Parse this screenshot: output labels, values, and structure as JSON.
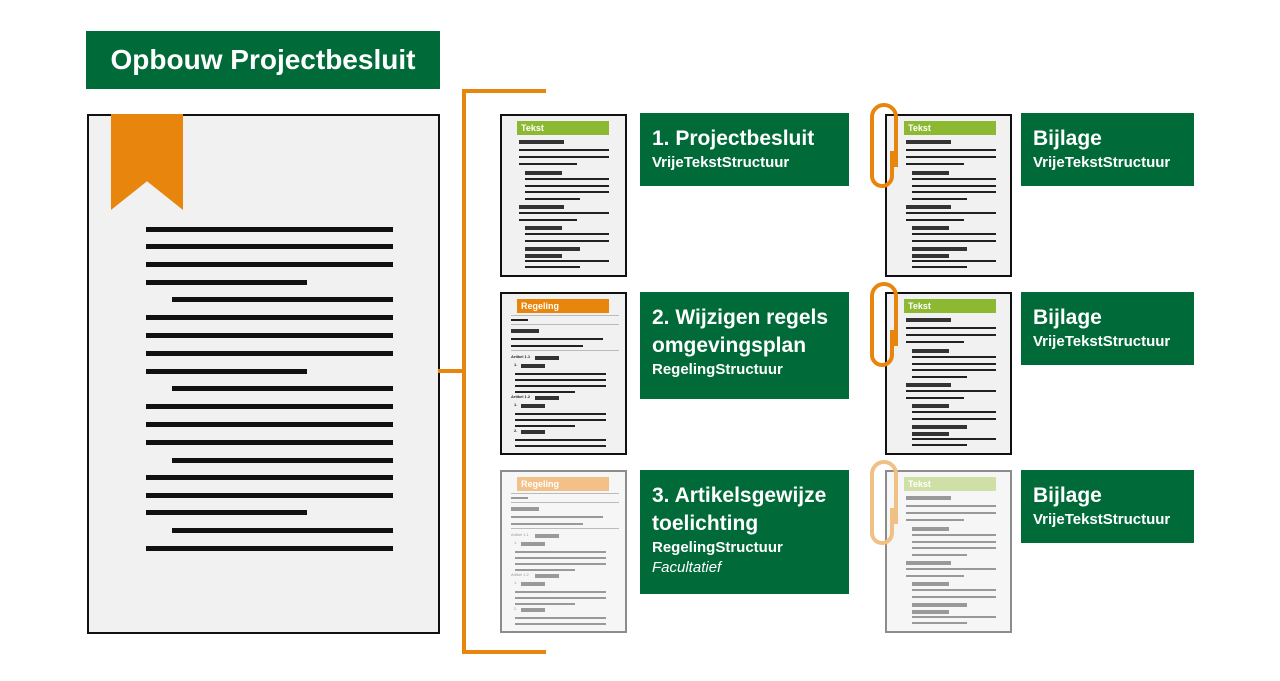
{
  "title": "Opbouw Projectbesluit",
  "colors": {
    "green": "#006b38",
    "orange": "#e8850c",
    "light_green": "#8db832"
  },
  "parts": [
    {
      "label": "1. Projectbesluit",
      "structure": "VrijeTekstStructuur",
      "doc_header": "Tekst"
    },
    {
      "label": "2. Wijzigen regels omgevingsplan",
      "structure": "RegelingStructuur",
      "doc_header": "Regeling"
    },
    {
      "label": "3. Artikelsgewijze toelichting",
      "structure": "RegelingStructuur",
      "note": "Facultatief",
      "doc_header": "Regeling"
    }
  ],
  "regeling_labels": {
    "art1": "Artikel 1.1",
    "art2": "Artikel 1.2",
    "lid1": "1.",
    "lid2": "2."
  },
  "attachments": [
    {
      "label": "Bijlage",
      "structure": "VrijeTekstStructuur",
      "doc_header": "Tekst"
    },
    {
      "label": "Bijlage",
      "structure": "VrijeTekstStructuur",
      "doc_header": "Tekst"
    },
    {
      "label": "Bijlage",
      "structure": "VrijeTekstStructuur",
      "doc_header": "Tekst"
    }
  ],
  "icons": [
    "bookmark-icon",
    "paperclip-icon",
    "document-icon"
  ]
}
